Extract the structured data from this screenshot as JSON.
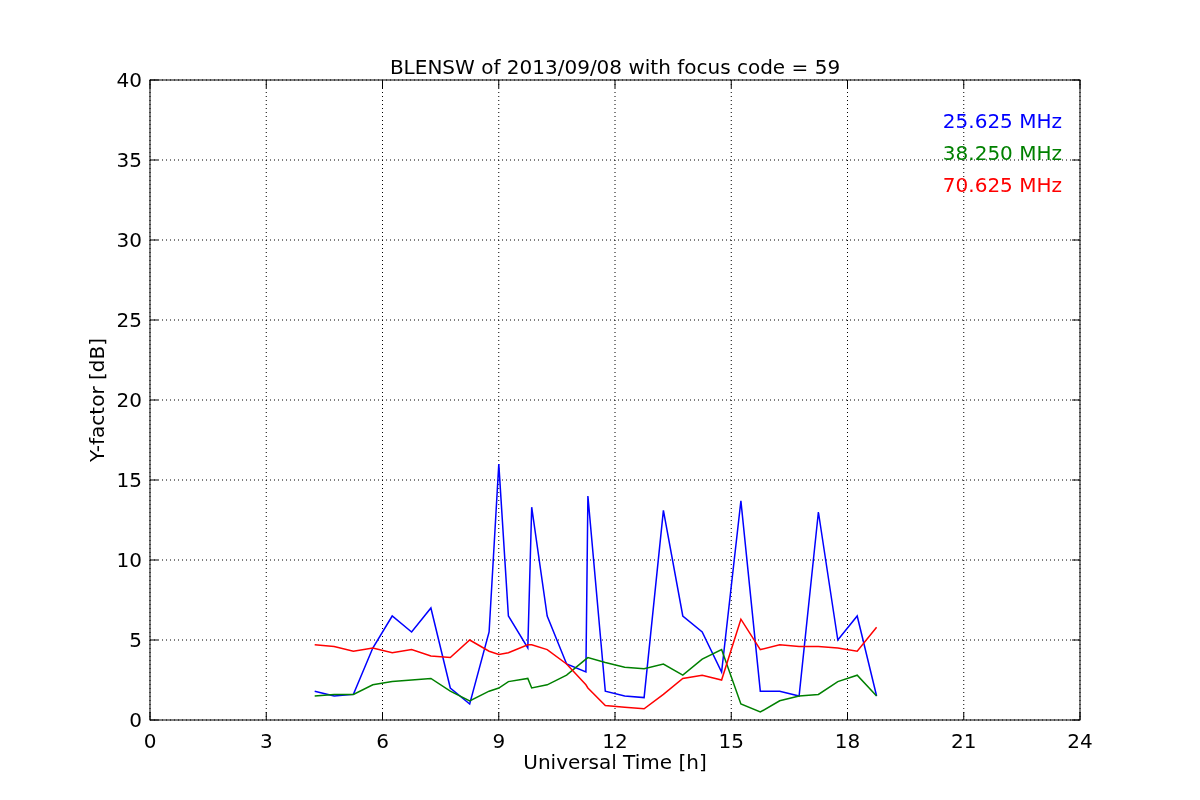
{
  "chart_data": {
    "type": "line",
    "grid": true,
    "title": "BLENSW of 2013/09/08 with focus code = 59",
    "xlabel": "Universal Time [h]",
    "ylabel": "Y-factor [dB]",
    "xlim": [
      0,
      24
    ],
    "ylim": [
      0,
      40
    ],
    "xticks": [
      0,
      3,
      6,
      9,
      12,
      15,
      18,
      21,
      24
    ],
    "yticks": [
      0,
      5,
      10,
      15,
      20,
      25,
      30,
      35,
      40
    ],
    "x": [
      4.25,
      4.75,
      5.25,
      5.75,
      6.25,
      6.75,
      7.25,
      7.75,
      8.25,
      8.75,
      9.0,
      9.25,
      9.75,
      9.85,
      10.25,
      10.75,
      11.25,
      11.3,
      11.75,
      12.25,
      12.75,
      13.25,
      13.75,
      14.25,
      14.75,
      15.25,
      15.75,
      16.25,
      16.75,
      17.25,
      17.75,
      18.25,
      18.75
    ],
    "series": [
      {
        "name": "25.625 MHz",
        "color": "#0000ff",
        "values": [
          1.8,
          1.5,
          1.6,
          4.5,
          6.5,
          5.5,
          7,
          2.0,
          1.0,
          5.5,
          16,
          6.5,
          4.5,
          13.3,
          6.5,
          3.5,
          3,
          14,
          1.8,
          1.5,
          1.4,
          13.1,
          6.5,
          5.5,
          3,
          13.7,
          1.8,
          1.8,
          1.5,
          13,
          5,
          6.5,
          1.5
        ]
      },
      {
        "name": "38.250 MHz",
        "color": "#008000",
        "values": [
          1.5,
          1.6,
          1.6,
          2.2,
          2.4,
          2.5,
          2.6,
          1.8,
          1.2,
          1.8,
          2.0,
          2.4,
          2.6,
          2.0,
          2.2,
          2.8,
          3.8,
          3.9,
          3.6,
          3.3,
          3.2,
          3.5,
          2.8,
          3.8,
          4.4,
          1.0,
          0.5,
          1.2,
          1.5,
          1.6,
          2.4,
          2.8,
          1.5
        ]
      },
      {
        "name": "70.625 MHz",
        "color": "#ff0000",
        "values": [
          4.7,
          4.6,
          4.3,
          4.5,
          4.2,
          4.4,
          4.0,
          3.9,
          5.0,
          4.3,
          4.1,
          4.2,
          4.7,
          4.7,
          4.4,
          3.5,
          2.2,
          2.0,
          0.9,
          0.8,
          0.7,
          1.6,
          2.6,
          2.8,
          2.5,
          6.3,
          4.4,
          4.7,
          4.6,
          4.6,
          4.5,
          4.3,
          5.8
        ]
      }
    ]
  }
}
